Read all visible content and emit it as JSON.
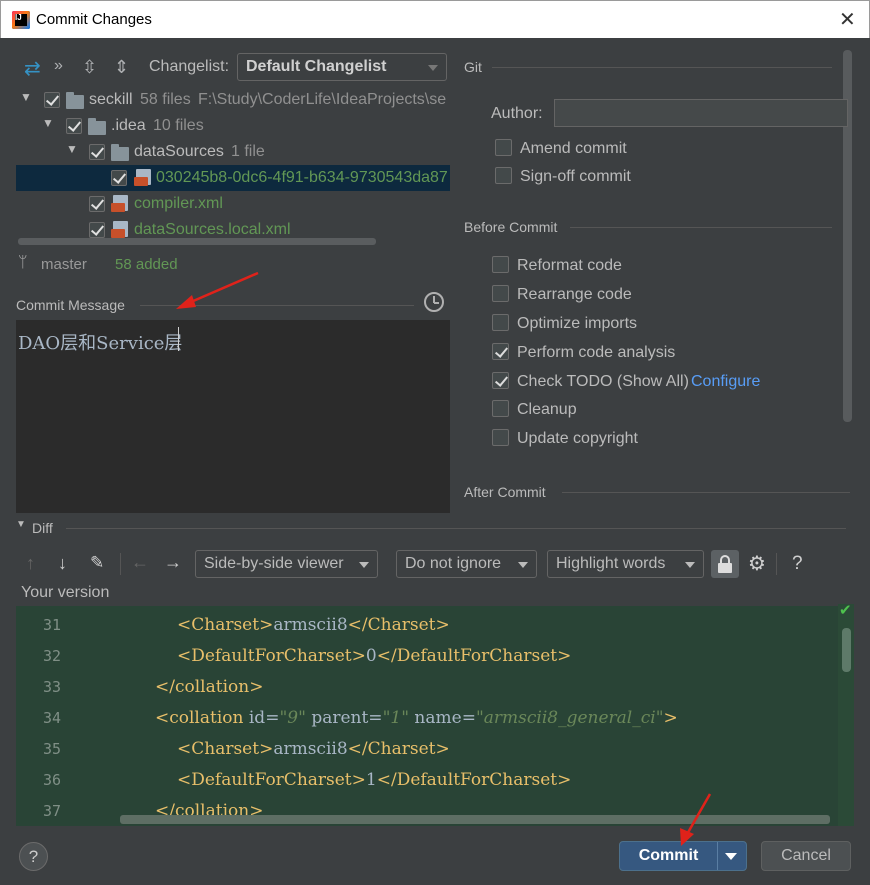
{
  "window": {
    "title": "Commit Changes",
    "close_glyph": "✕"
  },
  "toolbar": {
    "changelist_label": "Changelist:",
    "changelist_value": "Default Changelist",
    "icons": [
      "refresh-arrows-icon",
      "more-chevrons-icon",
      "expand-all-icon",
      "collapse-all-icon"
    ]
  },
  "tree": {
    "rows": [
      {
        "name": "seckill",
        "count": "58 files",
        "path": "F:\\Study\\CoderLife\\IdeaProjects\\se"
      },
      {
        "name": ".idea",
        "count": "10 files"
      },
      {
        "name": "dataSources",
        "count": "1 file"
      },
      {
        "name": "030245b8-0dc6-4f91-b634-9730543da87"
      },
      {
        "name": "compiler.xml"
      },
      {
        "name": "dataSources.local.xml"
      }
    ]
  },
  "vcs": {
    "branch": "master",
    "status": "58 added"
  },
  "commit_message": {
    "label": "Commit Message",
    "text": "DAO层和Service层"
  },
  "git": {
    "section": "Git",
    "author_label": "Author:",
    "author_value": "",
    "amend": "Amend commit",
    "signoff": "Sign-off commit"
  },
  "before_commit": {
    "section": "Before Commit",
    "options": [
      {
        "label": "Reformat code",
        "checked": false
      },
      {
        "label": "Rearrange code",
        "checked": false
      },
      {
        "label": "Optimize imports",
        "checked": false
      },
      {
        "label": "Perform code analysis",
        "checked": true
      },
      {
        "label": "Check TODO (Show All)",
        "checked": true,
        "link": "Configure"
      },
      {
        "label": "Cleanup",
        "checked": false
      },
      {
        "label": "Update copyright",
        "checked": false
      }
    ]
  },
  "after_commit": {
    "section": "After Commit"
  },
  "diff": {
    "section": "Diff",
    "viewer": "Side-by-side viewer",
    "ignore": "Do not ignore",
    "highlight": "Highlight words",
    "help": "?",
    "version_label": "Your version",
    "lines": [
      {
        "n": "31",
        "indent": 2,
        "parts": [
          [
            "t",
            "<Charset>"
          ],
          [
            "p",
            "armscii8"
          ],
          [
            "t",
            "</Charset>"
          ]
        ]
      },
      {
        "n": "32",
        "indent": 2,
        "parts": [
          [
            "t",
            "<DefaultForCharset>"
          ],
          [
            "p",
            "0"
          ],
          [
            "t",
            "</DefaultForCharset>"
          ]
        ]
      },
      {
        "n": "33",
        "indent": 1,
        "parts": [
          [
            "t",
            "</collation>"
          ]
        ]
      },
      {
        "n": "34",
        "indent": 1,
        "parts": [
          [
            "t",
            "<collation "
          ],
          [
            "p",
            "id="
          ],
          [
            "v",
            "\"9\""
          ],
          [
            "p",
            " parent="
          ],
          [
            "v",
            "\"1\""
          ],
          [
            "p",
            " name="
          ],
          [
            "v",
            "\"armscii8_general_ci\""
          ],
          [
            "t",
            ">"
          ]
        ]
      },
      {
        "n": "35",
        "indent": 2,
        "parts": [
          [
            "t",
            "<Charset>"
          ],
          [
            "p",
            "armscii8"
          ],
          [
            "t",
            "</Charset>"
          ]
        ]
      },
      {
        "n": "36",
        "indent": 2,
        "parts": [
          [
            "t",
            "<DefaultForCharset>"
          ],
          [
            "p",
            "1"
          ],
          [
            "t",
            "</DefaultForCharset>"
          ]
        ]
      },
      {
        "n": "37",
        "indent": 1,
        "parts": [
          [
            "t",
            "</collation>"
          ]
        ]
      }
    ]
  },
  "buttons": {
    "help": "?",
    "commit": "Commit",
    "cancel": "Cancel"
  },
  "colors": {
    "accent": "#365880",
    "link": "#589df6",
    "added": "#629755",
    "diff_bg": "#294436",
    "annotation": "#e0221a"
  }
}
